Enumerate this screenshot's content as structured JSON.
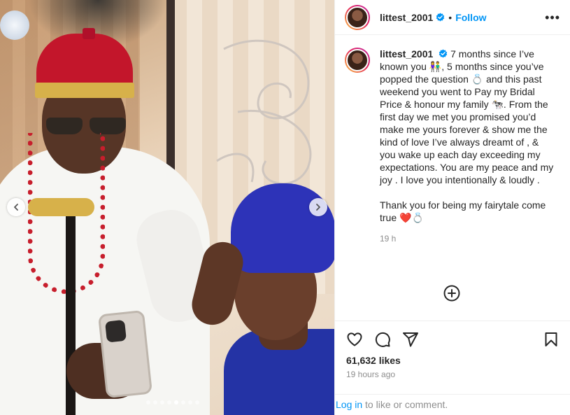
{
  "post": {
    "username": "littest_2001",
    "follow_label": "Follow",
    "separator": "•",
    "more_label": "•••",
    "caption_paragraph_1": "7 months since I’ve known you 👫, 5 months since you’ve popped the question 💍 and this past weekend you went to Pay my Bridal Price & honour my family 🐄. From the first day we met you promised you’d make me yours forever & show me the kind of love I’ve always dreamt of , & you wake up each day exceeding my expectations. You are my peace and my joy . I love you intentionally & loudly .",
    "caption_paragraph_2": "Thank you for being my fairytale come true ❤️💍",
    "caption_time": "19 h",
    "likes": "61,632 likes",
    "posted": "19 hours ago",
    "login_link": "Log in",
    "login_rest": " to like or comment."
  },
  "carousel": {
    "dot_count": 8,
    "active_index": 4
  },
  "colors": {
    "accent": "#0095f6",
    "verified": "#0095f6",
    "muted": "#8e8e8e"
  },
  "icons": {
    "header": [
      "verified-badge-icon",
      "more-options-icon"
    ],
    "actions": [
      "heart-icon",
      "comment-icon",
      "share-icon",
      "bookmark-icon"
    ],
    "carousel": [
      "chevron-left-icon",
      "chevron-right-icon"
    ],
    "add": "add-comment-icon"
  }
}
